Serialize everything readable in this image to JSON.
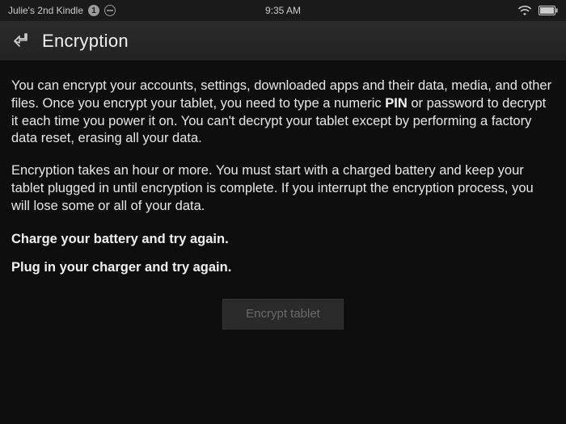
{
  "status": {
    "device_name": "Julie's 2nd Kindle",
    "badge": "1",
    "time": "9:35 AM"
  },
  "header": {
    "title": "Encryption"
  },
  "content": {
    "p1_pre": "You can encrypt your accounts, settings, downloaded apps and their data, media, and other files. Once you encrypt your tablet, you need to type a numeric ",
    "p1_bold": "PIN",
    "p1_post": " or password to decrypt it each time you power it on. You can't decrypt your tablet except by performing a factory data reset, erasing all your data.",
    "p2": "Encryption takes an hour or more. You must start with a charged battery and keep your tablet plugged in until encryption is complete. If you interrupt the encryption process, you will lose some or all of your data.",
    "charge_line": "Charge your battery and try again.",
    "plug_line": "Plug in your charger and try again.",
    "button": "Encrypt tablet"
  }
}
